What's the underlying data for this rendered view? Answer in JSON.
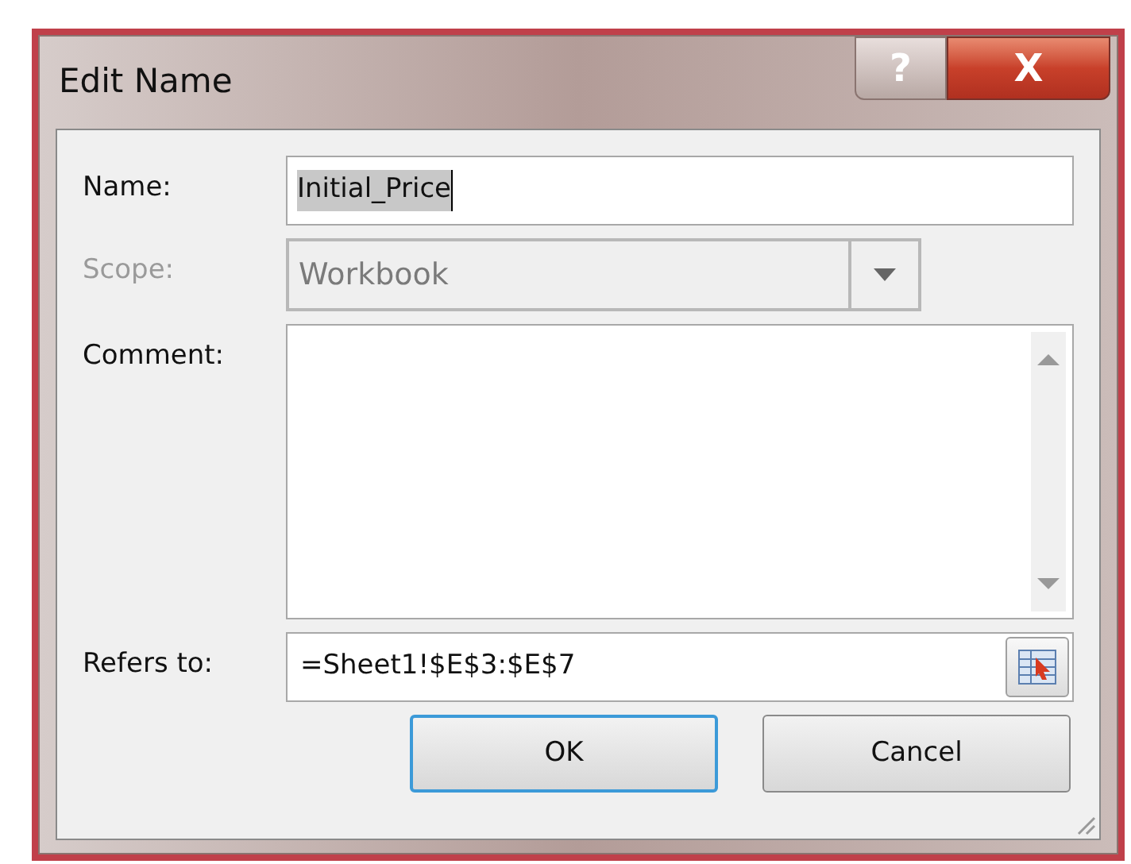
{
  "window": {
    "title": "Edit Name",
    "help_button": "?",
    "close_button": "X"
  },
  "fields": [
    {
      "kind": "text",
      "label": "Name:",
      "value": "Initial_Price",
      "disabled": false
    },
    {
      "kind": "dropdown",
      "label": "Scope:",
      "value": "Workbook",
      "disabled": true
    },
    {
      "kind": "textarea",
      "label": "Comment:",
      "disabled": false
    },
    {
      "kind": "reference",
      "label": "Refers to:",
      "value": "=Sheet1!$E$3:$E$7",
      "disabled": false
    }
  ],
  "buttons": [
    {
      "label": "OK",
      "default": true
    },
    {
      "label": "Cancel",
      "default": false
    }
  ]
}
